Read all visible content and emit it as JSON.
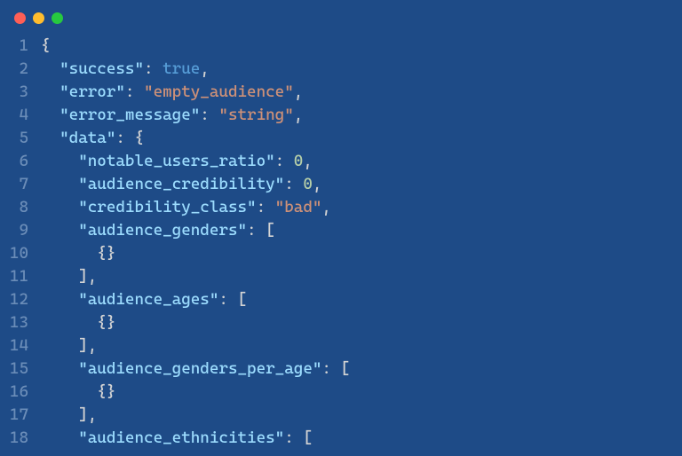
{
  "titlebar": {
    "dots": [
      "red",
      "yellow",
      "green"
    ]
  },
  "lines": [
    {
      "num": "1",
      "tokens": [
        {
          "t": "punct",
          "v": "{"
        }
      ]
    },
    {
      "num": "2",
      "tokens": [
        {
          "t": "punct",
          "v": "  "
        },
        {
          "t": "key",
          "v": "\"success\""
        },
        {
          "t": "punct",
          "v": ": "
        },
        {
          "t": "bool",
          "v": "true"
        },
        {
          "t": "punct",
          "v": ","
        }
      ]
    },
    {
      "num": "3",
      "tokens": [
        {
          "t": "punct",
          "v": "  "
        },
        {
          "t": "key",
          "v": "\"error\""
        },
        {
          "t": "punct",
          "v": ": "
        },
        {
          "t": "string",
          "v": "\"empty_audience\""
        },
        {
          "t": "punct",
          "v": ","
        }
      ]
    },
    {
      "num": "4",
      "tokens": [
        {
          "t": "punct",
          "v": "  "
        },
        {
          "t": "key",
          "v": "\"error_message\""
        },
        {
          "t": "punct",
          "v": ": "
        },
        {
          "t": "string",
          "v": "\"string\""
        },
        {
          "t": "punct",
          "v": ","
        }
      ]
    },
    {
      "num": "5",
      "tokens": [
        {
          "t": "punct",
          "v": "  "
        },
        {
          "t": "key",
          "v": "\"data\""
        },
        {
          "t": "punct",
          "v": ": {"
        }
      ]
    },
    {
      "num": "6",
      "tokens": [
        {
          "t": "punct",
          "v": "    "
        },
        {
          "t": "key",
          "v": "\"notable_users_ratio\""
        },
        {
          "t": "punct",
          "v": ": "
        },
        {
          "t": "number",
          "v": "0"
        },
        {
          "t": "punct",
          "v": ","
        }
      ]
    },
    {
      "num": "7",
      "tokens": [
        {
          "t": "punct",
          "v": "    "
        },
        {
          "t": "key",
          "v": "\"audience_credibility\""
        },
        {
          "t": "punct",
          "v": ": "
        },
        {
          "t": "number",
          "v": "0"
        },
        {
          "t": "punct",
          "v": ","
        }
      ]
    },
    {
      "num": "8",
      "tokens": [
        {
          "t": "punct",
          "v": "    "
        },
        {
          "t": "key",
          "v": "\"credibility_class\""
        },
        {
          "t": "punct",
          "v": ": "
        },
        {
          "t": "string",
          "v": "\"bad\""
        },
        {
          "t": "punct",
          "v": ","
        }
      ]
    },
    {
      "num": "9",
      "tokens": [
        {
          "t": "punct",
          "v": "    "
        },
        {
          "t": "key",
          "v": "\"audience_genders\""
        },
        {
          "t": "punct",
          "v": ": ["
        }
      ]
    },
    {
      "num": "10",
      "tokens": [
        {
          "t": "punct",
          "v": "      {}"
        }
      ]
    },
    {
      "num": "11",
      "tokens": [
        {
          "t": "punct",
          "v": "    ],"
        }
      ]
    },
    {
      "num": "12",
      "tokens": [
        {
          "t": "punct",
          "v": "    "
        },
        {
          "t": "key",
          "v": "\"audience_ages\""
        },
        {
          "t": "punct",
          "v": ": ["
        }
      ]
    },
    {
      "num": "13",
      "tokens": [
        {
          "t": "punct",
          "v": "      {}"
        }
      ]
    },
    {
      "num": "14",
      "tokens": [
        {
          "t": "punct",
          "v": "    ],"
        }
      ]
    },
    {
      "num": "15",
      "tokens": [
        {
          "t": "punct",
          "v": "    "
        },
        {
          "t": "key",
          "v": "\"audience_genders_per_age\""
        },
        {
          "t": "punct",
          "v": ": ["
        }
      ]
    },
    {
      "num": "16",
      "tokens": [
        {
          "t": "punct",
          "v": "      {}"
        }
      ]
    },
    {
      "num": "17",
      "tokens": [
        {
          "t": "punct",
          "v": "    ],"
        }
      ]
    },
    {
      "num": "18",
      "tokens": [
        {
          "t": "punct",
          "v": "    "
        },
        {
          "t": "key",
          "v": "\"audience_ethnicities\""
        },
        {
          "t": "punct",
          "v": ": ["
        }
      ]
    }
  ]
}
